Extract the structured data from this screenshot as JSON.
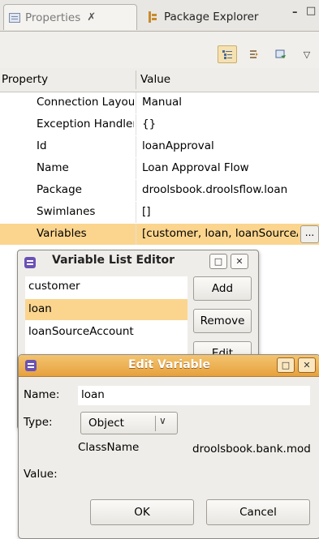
{
  "tabs": {
    "properties_label": "Properties",
    "properties_close": "✗",
    "package_explorer_label": "Package Explorer"
  },
  "window_controls": {
    "minimize": "–",
    "maximize": "□"
  },
  "toolbar": {
    "icons": [
      "show-categories-icon",
      "show-advanced-icon",
      "restore-defaults-icon",
      "view-menu-icon"
    ],
    "menu_glyph": "▽"
  },
  "table": {
    "headers": {
      "property": "Property",
      "value": "Value"
    },
    "rows": [
      {
        "property": "Connection Layout",
        "value": "Manual"
      },
      {
        "property": "Exception Handlers",
        "value": "{}"
      },
      {
        "property": "Id",
        "value": "loanApproval"
      },
      {
        "property": "Name",
        "value": "Loan Approval Flow"
      },
      {
        "property": "Package",
        "value": "droolsbook.droolsflow.loan"
      },
      {
        "property": "Swimlanes",
        "value": "[]"
      },
      {
        "property": "Variables",
        "value": "[customer, loan, loanSourceAccount]"
      }
    ],
    "selected_row": "Variables",
    "ellipsis_button": "...",
    "selection_color": "#fbd58e"
  },
  "variable_list_editor": {
    "title": "Variable List Editor",
    "items": [
      "customer",
      "loan",
      "loanSourceAccount"
    ],
    "selected": "loan",
    "buttons": {
      "add": "Add",
      "remove": "Remove",
      "edit": "Edit"
    },
    "max_glyph": "□",
    "close_glyph": "✕"
  },
  "edit_variable": {
    "title": "Edit Variable",
    "labels": {
      "name": "Name:",
      "type": "Type:",
      "classname": "ClassName",
      "value": "Value:"
    },
    "name_value": "loan",
    "type_value": "Object",
    "chevron": "∨",
    "classname_value": "droolsbook.bank.model.Loan",
    "buttons": {
      "ok": "OK",
      "cancel": "Cancel"
    },
    "max_glyph": "□",
    "close_glyph": "✕",
    "title_color": "#e7a13d"
  }
}
